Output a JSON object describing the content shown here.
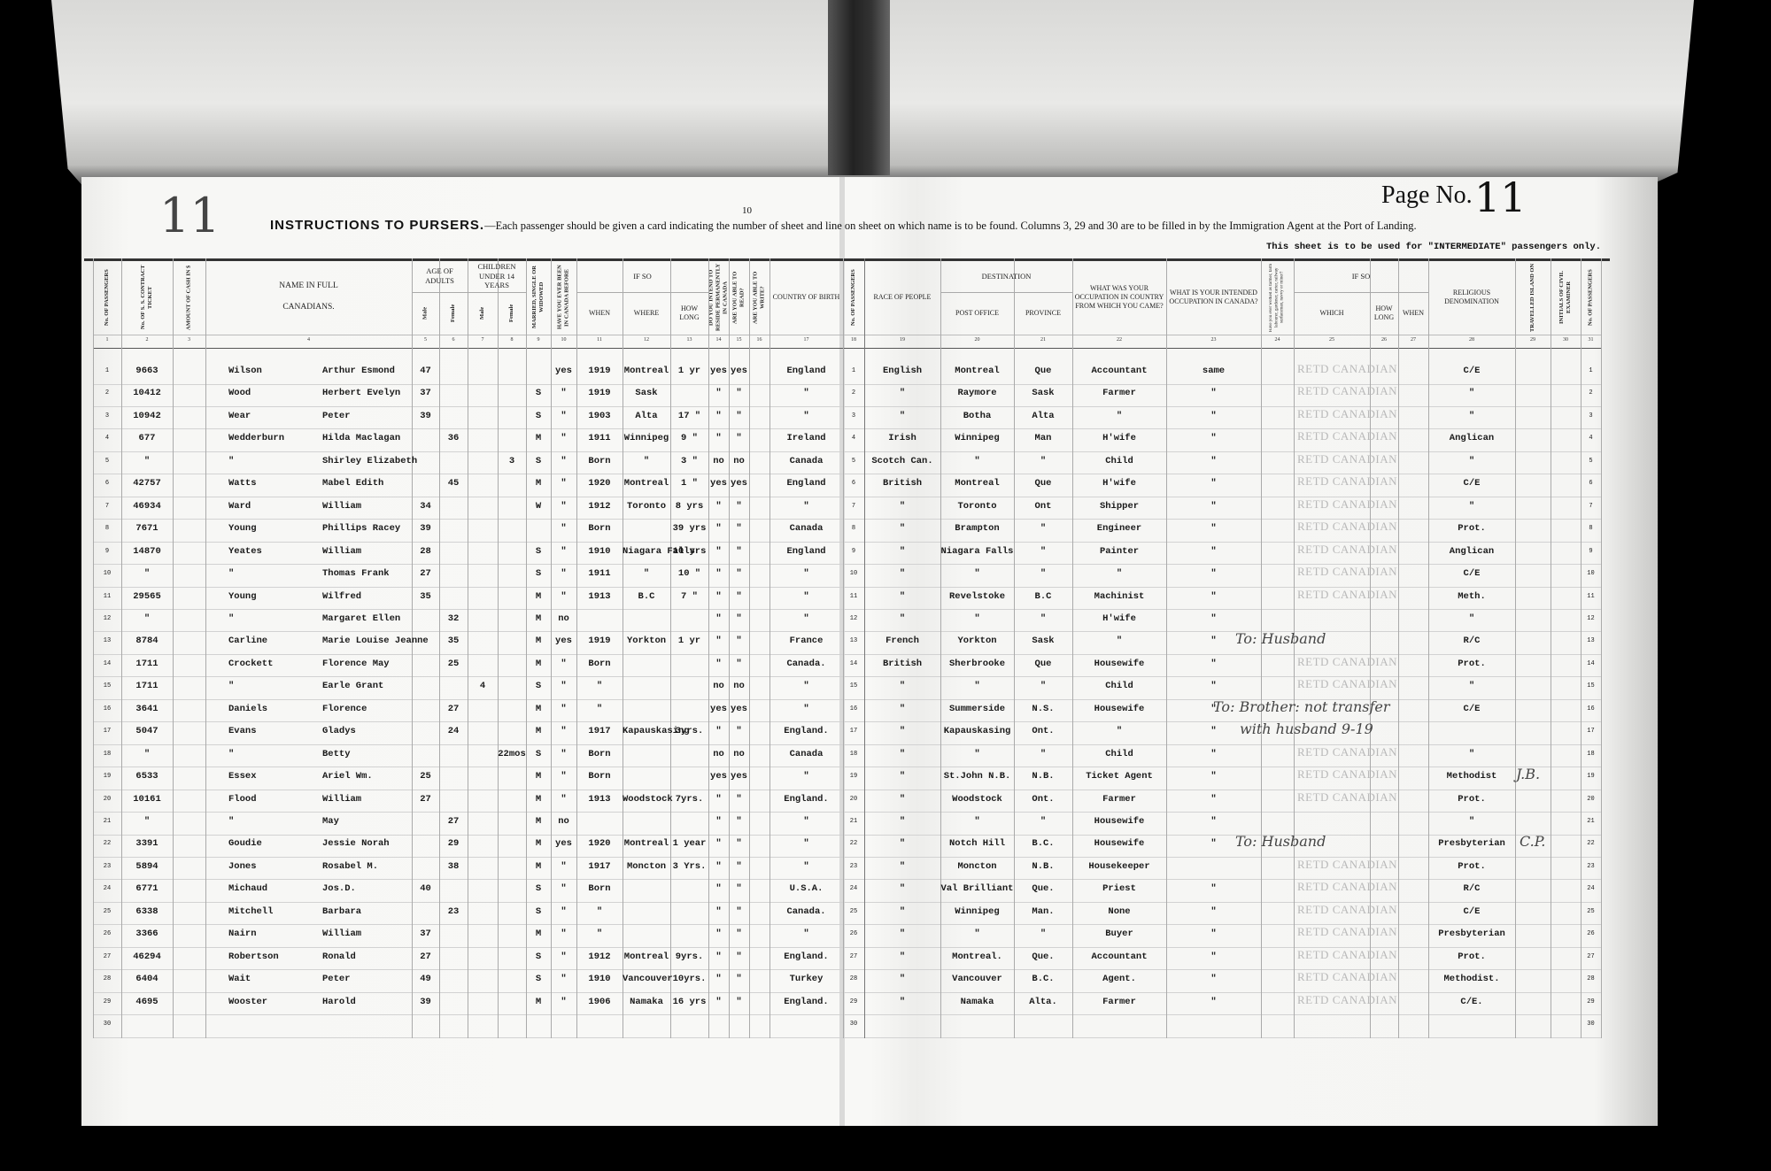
{
  "page": {
    "sheet_number": "10",
    "page_no_label": "Page No.",
    "page_no_value": "11",
    "margin_handwritten": "11",
    "instructions_title": "INSTRUCTIONS TO PURSERS.",
    "instructions_text": "—Each passenger should be given a card indicating the number of sheet and line on sheet on which name is to be found.   Columns 3, 29 and 30 are to be filled in by the Immigration Agent at the Port of Landing.",
    "sheet_note": "This sheet is to be used for \"INTERMEDIATE\" passengers only."
  },
  "headers": {
    "columns": [
      "No. OF PASSENGERS",
      "No. OF S. S. CONTRACT TICKET",
      "AMOUNT OF CASH IN $",
      "NAME IN FULL\n\nCANADIANS.",
      "Male",
      "Female",
      "Male",
      "Female",
      "MARRIED, SINGLE OR WIDOWED",
      "HAVE YOU EVER BEEN IN CANADA BEFORE",
      "WHEN",
      "WHERE",
      "HOW LONG",
      "DO YOU INTEND TO RESIDE PERMANENTLY IN CANADA",
      "ARE YOU ABLE TO READ?",
      "ARE YOU ABLE TO WRITE?",
      "COUNTRY OF BIRTH",
      "No. OF PASSENGERS",
      "RACE OF PEOPLE",
      "POST OFFICE",
      "PROVINCE",
      "WHAT WAS YOUR OCCUPATION IN COUNTRY FROM WHICH YOU CAME?",
      "WHAT IS YOUR INTENDED OCCUPATION IN CANADA?",
      "Have you ever worked as farmer, farm labourer, gardener, carter, railway surfaceman, navvy or miner?",
      "WHICH",
      "HOW LONG",
      "WHEN",
      "RELIGIOUS DENOMINATION",
      "TRAVELLED ISLAND ON",
      "INITIALS OF CIVIL EXAMINER",
      "No. OF PASSENGERS"
    ],
    "groups": [
      {
        "label": "AGE OF ADULTS",
        "from": 4,
        "to": 5
      },
      {
        "label": "CHILDREN UNDER 14 YEARS",
        "from": 6,
        "to": 7
      },
      {
        "label": "IF SO",
        "from": 10,
        "to": 12
      },
      {
        "label": "DESTINATION",
        "from": 19,
        "to": 20
      },
      {
        "label": "IF SO",
        "from": 24,
        "to": 26
      }
    ],
    "column_numbers": [
      "1",
      "2",
      "3",
      "4",
      "5",
      "6",
      "7",
      "8",
      "9",
      "10",
      "11",
      "12",
      "13",
      "14",
      "15",
      "16",
      "17",
      "18",
      "19",
      "20",
      "21",
      "22",
      "23",
      "24",
      "25",
      "26",
      "27",
      "28",
      "29",
      "30",
      "31"
    ]
  },
  "stamp_text": "RETD CANADIAN",
  "rows": [
    {
      "no": "1",
      "ticket": "9663",
      "surname": "Wilson",
      "given": "Arthur Esmond",
      "age_m": "47",
      "age_f": "",
      "ch_m": "",
      "ch_f": "",
      "marital": "",
      "before": "yes",
      "when": "1919",
      "where": "Montreal",
      "how_long": "1 yr",
      "reside": "yes",
      "read": "yes",
      "write": "",
      "country": "England",
      "race": "English",
      "post_office": "Montreal",
      "province": "Que",
      "occ_prev": "Accountant",
      "occ_int": "same",
      "stamp": true,
      "religion": "C/E"
    },
    {
      "no": "2",
      "ticket": "10412",
      "surname": "Wood",
      "given": "Herbert Evelyn",
      "age_m": "37",
      "age_f": "",
      "ch_m": "",
      "ch_f": "",
      "marital": "S",
      "before": "\"",
      "when": "1919",
      "where": "Sask",
      "how_long": "",
      "reside": "\"",
      "read": "\"",
      "write": "",
      "country": "\"",
      "race": "\"",
      "post_office": "Raymore",
      "province": "Sask",
      "occ_prev": "Farmer",
      "occ_int": "\"",
      "stamp": true,
      "religion": "\""
    },
    {
      "no": "3",
      "ticket": "10942",
      "surname": "Wear",
      "given": "Peter",
      "age_m": "39",
      "age_f": "",
      "ch_m": "",
      "ch_f": "",
      "marital": "S",
      "before": "\"",
      "when": "1903",
      "where": "Alta",
      "how_long": "17 \"",
      "reside": "\"",
      "read": "\"",
      "write": "",
      "country": "\"",
      "race": "\"",
      "post_office": "Botha",
      "province": "Alta",
      "occ_prev": "\"",
      "occ_int": "\"",
      "stamp": true,
      "religion": "\""
    },
    {
      "no": "4",
      "ticket": "677",
      "surname": "Wedderburn",
      "given": "Hilda Maclagan",
      "age_m": "",
      "age_f": "36",
      "ch_m": "",
      "ch_f": "",
      "marital": "M",
      "before": "\"",
      "when": "1911",
      "where": "Winnipeg",
      "how_long": "9 \"",
      "reside": "\"",
      "read": "\"",
      "write": "",
      "country": "Ireland",
      "race": "Irish",
      "post_office": "Winnipeg",
      "province": "Man",
      "occ_prev": "H'wife",
      "occ_int": "\"",
      "stamp": true,
      "religion": "Anglican"
    },
    {
      "no": "5",
      "ticket": "\"",
      "surname": "\"",
      "given": "Shirley Elizabeth",
      "age_m": "",
      "age_f": "",
      "ch_m": "",
      "ch_f": "3",
      "marital": "S",
      "before": "\"",
      "when": "Born",
      "where": "\"",
      "how_long": "3 \"",
      "reside": "no",
      "read": "no",
      "write": "",
      "country": "Canada",
      "race": "Scotch Can.",
      "post_office": "\"",
      "province": "\"",
      "occ_prev": "Child",
      "occ_int": "\"",
      "stamp": true,
      "religion": "\""
    },
    {
      "no": "6",
      "ticket": "42757",
      "surname": "Watts",
      "given": "Mabel Edith",
      "age_m": "",
      "age_f": "45",
      "ch_m": "",
      "ch_f": "",
      "marital": "M",
      "before": "\"",
      "when": "1920",
      "where": "Montreal",
      "how_long": "1 \"",
      "reside": "yes",
      "read": "yes",
      "write": "",
      "country": "England",
      "race": "British",
      "post_office": "Montreal",
      "province": "Que",
      "occ_prev": "H'wife",
      "occ_int": "\"",
      "stamp": true,
      "religion": "C/E"
    },
    {
      "no": "7",
      "ticket": "46934",
      "surname": "Ward",
      "given": "William",
      "age_m": "34",
      "age_f": "",
      "ch_m": "",
      "ch_f": "",
      "marital": "W",
      "before": "\"",
      "when": "1912",
      "where": "Toronto",
      "how_long": "8 yrs",
      "reside": "\"",
      "read": "\"",
      "write": "",
      "country": "\"",
      "race": "\"",
      "post_office": "Toronto",
      "province": "Ont",
      "occ_prev": "Shipper",
      "occ_int": "\"",
      "stamp": true,
      "religion": "\""
    },
    {
      "no": "8",
      "ticket": "7671",
      "surname": "Young",
      "given": "Phillips Racey",
      "age_m": "39",
      "age_f": "",
      "ch_m": "",
      "ch_f": "",
      "marital": "",
      "before": "\"",
      "when": "Born",
      "where": "",
      "how_long": "39 yrs",
      "reside": "\"",
      "read": "\"",
      "write": "",
      "country": "Canada",
      "race": "\"",
      "post_office": "Brampton",
      "province": "\"",
      "occ_prev": "Engineer",
      "occ_int": "\"",
      "stamp": true,
      "religion": "Prot."
    },
    {
      "no": "9",
      "ticket": "14870",
      "surname": "Yeates",
      "given": "William",
      "age_m": "28",
      "age_f": "",
      "ch_m": "",
      "ch_f": "",
      "marital": "S",
      "before": "\"",
      "when": "1910",
      "where": "Niagara Falls",
      "how_long": "10 yrs",
      "reside": "\"",
      "read": "\"",
      "write": "",
      "country": "England",
      "race": "\"",
      "post_office": "Niagara Falls",
      "province": "\"",
      "occ_prev": "Painter",
      "occ_int": "\"",
      "stamp": true,
      "religion": "Anglican"
    },
    {
      "no": "10",
      "ticket": "\"",
      "surname": "\"",
      "given": "Thomas Frank",
      "age_m": "27",
      "age_f": "",
      "ch_m": "",
      "ch_f": "",
      "marital": "S",
      "before": "\"",
      "when": "1911",
      "where": "\"",
      "how_long": "10 \"",
      "reside": "\"",
      "read": "\"",
      "write": "",
      "country": "\"",
      "race": "\"",
      "post_office": "\"",
      "province": "\"",
      "occ_prev": "\"",
      "occ_int": "\"",
      "stamp": true,
      "religion": "C/E"
    },
    {
      "no": "11",
      "ticket": "29565",
      "surname": "Young",
      "given": "Wilfred",
      "age_m": "35",
      "age_f": "",
      "ch_m": "",
      "ch_f": "",
      "marital": "M",
      "before": "\"",
      "when": "1913",
      "where": "B.C",
      "how_long": "7 \"",
      "reside": "\"",
      "read": "\"",
      "write": "",
      "country": "\"",
      "race": "\"",
      "post_office": "Revelstoke",
      "province": "B.C",
      "occ_prev": "Machinist",
      "occ_int": "\"",
      "stamp": true,
      "religion": "Meth."
    },
    {
      "no": "12",
      "ticket": "\"",
      "surname": "\"",
      "given": "Margaret Ellen",
      "age_m": "",
      "age_f": "32",
      "ch_m": "",
      "ch_f": "",
      "marital": "M",
      "before": "no",
      "when": "",
      "where": "",
      "how_long": "",
      "reside": "\"",
      "read": "\"",
      "write": "",
      "country": "\"",
      "race": "\"",
      "post_office": "\"",
      "province": "\"",
      "occ_prev": "H'wife",
      "occ_int": "\"",
      "stamp": false,
      "religion": "\""
    },
    {
      "no": "13",
      "ticket": "8784",
      "surname": "Carline",
      "given": "Marie Louise Jeanne",
      "age_m": "",
      "age_f": "35",
      "ch_m": "",
      "ch_f": "",
      "marital": "M",
      "before": "yes",
      "when": "1919",
      "where": "Yorkton",
      "how_long": "1 yr",
      "reside": "\"",
      "read": "\"",
      "write": "",
      "country": "France",
      "race": "French",
      "post_office": "Yorkton",
      "province": "Sask",
      "occ_prev": "\"",
      "occ_int": "\"",
      "stamp": false,
      "religion": "R/C"
    },
    {
      "no": "14",
      "ticket": "1711",
      "surname": "Crockett",
      "given": "Florence May",
      "age_m": "",
      "age_f": "25",
      "ch_m": "",
      "ch_f": "",
      "marital": "M",
      "before": "\"",
      "when": "Born",
      "where": "",
      "how_long": "",
      "reside": "\"",
      "read": "\"",
      "write": "",
      "country": "Canada.",
      "race": "British",
      "post_office": "Sherbrooke",
      "province": "Que",
      "occ_prev": "Housewife",
      "occ_int": "\"",
      "stamp": true,
      "religion": "Prot."
    },
    {
      "no": "15",
      "ticket": "1711",
      "surname": "\"",
      "given": "Earle Grant",
      "age_m": "",
      "age_f": "",
      "ch_m": "4",
      "ch_f": "",
      "marital": "S",
      "before": "\"",
      "when": "\"",
      "where": "",
      "how_long": "",
      "reside": "no",
      "read": "no",
      "write": "",
      "country": "\"",
      "race": "\"",
      "post_office": "\"",
      "province": "\"",
      "occ_prev": "Child",
      "occ_int": "\"",
      "stamp": true,
      "religion": "\""
    },
    {
      "no": "16",
      "ticket": "3641",
      "surname": "Daniels",
      "given": "Florence",
      "age_m": "",
      "age_f": "27",
      "ch_m": "",
      "ch_f": "",
      "marital": "M",
      "before": "\"",
      "when": "\"",
      "where": "",
      "how_long": "",
      "reside": "yes",
      "read": "yes",
      "write": "",
      "country": "\"",
      "race": "\"",
      "post_office": "Summerside",
      "province": "N.S.",
      "occ_prev": "Housewife",
      "occ_int": "\"",
      "stamp": false,
      "religion": "C/E"
    },
    {
      "no": "17",
      "ticket": "5047",
      "surname": "Evans",
      "given": "Gladys",
      "age_m": "",
      "age_f": "24",
      "ch_m": "",
      "ch_f": "",
      "marital": "M",
      "before": "\"",
      "when": "1917",
      "where": "Kapauskasing",
      "how_long": "3yrs.",
      "reside": "\"",
      "read": "\"",
      "write": "",
      "country": "England.",
      "race": "\"",
      "post_office": "Kapauskasing",
      "province": "Ont.",
      "occ_prev": "\"",
      "occ_int": "\"",
      "stamp": false,
      "religion": ""
    },
    {
      "no": "18",
      "ticket": "\"",
      "surname": "\"",
      "given": "Betty",
      "age_m": "",
      "age_f": "",
      "ch_m": "",
      "ch_f": "22mos",
      "marital": "S",
      "before": "\"",
      "when": "Born",
      "where": "",
      "how_long": "",
      "reside": "no",
      "read": "no",
      "write": "",
      "country": "Canada",
      "race": "\"",
      "post_office": "\"",
      "province": "\"",
      "occ_prev": "Child",
      "occ_int": "\"",
      "stamp": true,
      "religion": "\""
    },
    {
      "no": "19",
      "ticket": "6533",
      "surname": "Essex",
      "given": "Ariel Wm.",
      "age_m": "25",
      "age_f": "",
      "ch_m": "",
      "ch_f": "",
      "marital": "M",
      "before": "\"",
      "when": "Born",
      "where": "",
      "how_long": "",
      "reside": "yes",
      "read": "yes",
      "write": "",
      "country": "\"",
      "race": "\"",
      "post_office": "St.John N.B.",
      "province": "N.B.",
      "occ_prev": "Ticket Agent",
      "occ_int": "\"",
      "stamp": true,
      "religion": "Methodist"
    },
    {
      "no": "20",
      "ticket": "10161",
      "surname": "Flood",
      "given": "William",
      "age_m": "27",
      "age_f": "",
      "ch_m": "",
      "ch_f": "",
      "marital": "M",
      "before": "\"",
      "when": "1913",
      "where": "Woodstock",
      "how_long": "7yrs.",
      "reside": "\"",
      "read": "\"",
      "write": "",
      "country": "England.",
      "race": "\"",
      "post_office": "Woodstock",
      "province": "Ont.",
      "occ_prev": "Farmer",
      "occ_int": "\"",
      "stamp": true,
      "religion": "Prot."
    },
    {
      "no": "21",
      "ticket": "\"",
      "surname": "\"",
      "given": "May",
      "age_m": "",
      "age_f": "27",
      "ch_m": "",
      "ch_f": "",
      "marital": "M",
      "before": "no",
      "when": "",
      "where": "",
      "how_long": "",
      "reside": "\"",
      "read": "\"",
      "write": "",
      "country": "\"",
      "race": "\"",
      "post_office": "\"",
      "province": "\"",
      "occ_prev": "Housewife",
      "occ_int": "\"",
      "stamp": false,
      "religion": "\""
    },
    {
      "no": "22",
      "ticket": "3391",
      "surname": "Goudie",
      "given": "Jessie Norah",
      "age_m": "",
      "age_f": "29",
      "ch_m": "",
      "ch_f": "",
      "marital": "M",
      "before": "yes",
      "when": "1920",
      "where": "Montreal",
      "how_long": "1 year",
      "reside": "\"",
      "read": "\"",
      "write": "",
      "country": "\"",
      "race": "\"",
      "post_office": "Notch Hill",
      "province": "B.C.",
      "occ_prev": "Housewife",
      "occ_int": "\"",
      "stamp": false,
      "religion": "Presbyterian"
    },
    {
      "no": "23",
      "ticket": "5894",
      "surname": "Jones",
      "given": "Rosabel M.",
      "age_m": "",
      "age_f": "38",
      "ch_m": "",
      "ch_f": "",
      "marital": "M",
      "before": "\"",
      "when": "1917",
      "where": "Moncton",
      "how_long": "3 Yrs.",
      "reside": "\"",
      "read": "\"",
      "write": "",
      "country": "\"",
      "race": "\"",
      "post_office": "Moncton",
      "province": "N.B.",
      "occ_prev": "Housekeeper",
      "occ_int": "",
      "stamp": true,
      "religion": "Prot."
    },
    {
      "no": "24",
      "ticket": "6771",
      "surname": "Michaud",
      "given": "Jos.D.",
      "age_m": "40",
      "age_f": "",
      "ch_m": "",
      "ch_f": "",
      "marital": "S",
      "before": "\"",
      "when": "Born",
      "where": "",
      "how_long": "",
      "reside": "\"",
      "read": "\"",
      "write": "",
      "country": "U.S.A.",
      "race": "\"",
      "post_office": "Val Brilliant",
      "province": "Que.",
      "occ_prev": "Priest",
      "occ_int": "\"",
      "stamp": true,
      "religion": "R/C"
    },
    {
      "no": "25",
      "ticket": "6338",
      "surname": "Mitchell",
      "given": "Barbara",
      "age_m": "",
      "age_f": "23",
      "ch_m": "",
      "ch_f": "",
      "marital": "S",
      "before": "\"",
      "when": "\"",
      "where": "",
      "how_long": "",
      "reside": "\"",
      "read": "\"",
      "write": "",
      "country": "Canada.",
      "race": "\"",
      "post_office": "Winnipeg",
      "province": "Man.",
      "occ_prev": "None",
      "occ_int": "\"",
      "stamp": true,
      "religion": "C/E"
    },
    {
      "no": "26",
      "ticket": "3366",
      "surname": "Nairn",
      "given": "William",
      "age_m": "37",
      "age_f": "",
      "ch_m": "",
      "ch_f": "",
      "marital": "M",
      "before": "\"",
      "when": "\"",
      "where": "",
      "how_long": "",
      "reside": "\"",
      "read": "\"",
      "write": "",
      "country": "\"",
      "race": "\"",
      "post_office": "\"",
      "province": "\"",
      "occ_prev": "Buyer",
      "occ_int": "\"",
      "stamp": true,
      "religion": "Presbyterian"
    },
    {
      "no": "27",
      "ticket": "46294",
      "surname": "Robertson",
      "given": "Ronald",
      "age_m": "27",
      "age_f": "",
      "ch_m": "",
      "ch_f": "",
      "marital": "S",
      "before": "\"",
      "when": "1912",
      "where": "Montreal",
      "how_long": "9yrs.",
      "reside": "\"",
      "read": "\"",
      "write": "",
      "country": "England.",
      "race": "\"",
      "post_office": "Montreal.",
      "province": "Que.",
      "occ_prev": "Accountant",
      "occ_int": "\"",
      "stamp": true,
      "religion": "Prot."
    },
    {
      "no": "28",
      "ticket": "6404",
      "surname": "Wait",
      "given": "Peter",
      "age_m": "49",
      "age_f": "",
      "ch_m": "",
      "ch_f": "",
      "marital": "S",
      "before": "\"",
      "when": "1910",
      "where": "Vancouver",
      "how_long": "10yrs.",
      "reside": "\"",
      "read": "\"",
      "write": "",
      "country": "Turkey",
      "race": "\"",
      "post_office": "Vancouver",
      "province": "B.C.",
      "occ_prev": "Agent.",
      "occ_int": "\"",
      "stamp": true,
      "religion": "Methodist."
    },
    {
      "no": "29",
      "ticket": "4695",
      "surname": "Wooster",
      "given": "Harold",
      "age_m": "39",
      "age_f": "",
      "ch_m": "",
      "ch_f": "",
      "marital": "M",
      "before": "\"",
      "when": "1906",
      "where": "Namaka",
      "how_long": "16 yrs",
      "reside": "\"",
      "read": "\"",
      "write": "",
      "country": "England.",
      "race": "\"",
      "post_office": "Namaka",
      "province": "Alta.",
      "occ_prev": "Farmer",
      "occ_int": "\"",
      "stamp": true,
      "religion": "C/E."
    },
    {
      "no": "30",
      "ticket": "",
      "surname": "",
      "given": "",
      "age_m": "",
      "age_f": "",
      "ch_m": "",
      "ch_f": "",
      "marital": "",
      "before": "",
      "when": "",
      "where": "",
      "how_long": "",
      "reside": "",
      "read": "",
      "write": "",
      "country": "",
      "race": "",
      "post_office": "",
      "province": "",
      "occ_prev": "",
      "occ_int": "",
      "stamp": false,
      "religion": ""
    }
  ],
  "annotations": [
    {
      "text": "To: Husband",
      "row": 13
    },
    {
      "text": "To: Brother: not transfer",
      "row": 16
    },
    {
      "text": "with husband 9-19",
      "row": 17
    },
    {
      "text": "J.B.",
      "row": 19
    },
    {
      "text": "To: Husband",
      "row": 22
    },
    {
      "text": "C.P.",
      "row": 22
    }
  ],
  "colors": {
    "paper": "#f7f7f5",
    "ink": "#1a1a1a",
    "stamp": "#b9b9b9",
    "background": "#000000"
  }
}
